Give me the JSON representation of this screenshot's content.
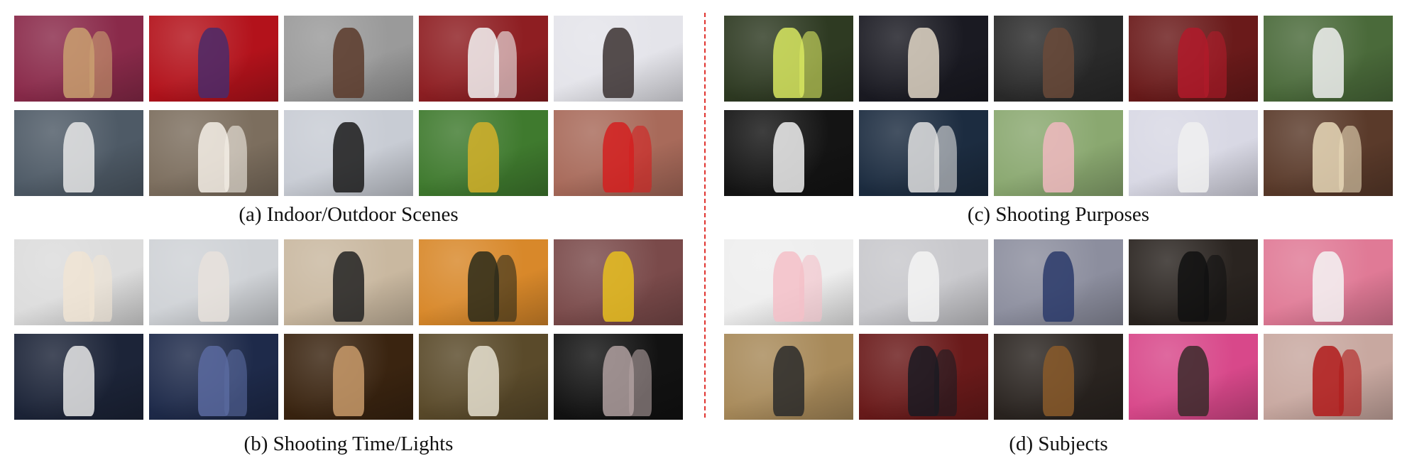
{
  "captions": {
    "a": "(a) Indoor/Outdoor Scenes",
    "b": "(b) Shooting Time/Lights",
    "c": "(c) Shooting Purposes",
    "d": "(d) Subjects"
  },
  "colors": {
    "divider": "#e0332f"
  },
  "panels": {
    "a": [
      {
        "bg": "#8a2a4a",
        "fg": "#c9a070"
      },
      {
        "bg": "#b3121b",
        "fg": "#4a2a6a"
      },
      {
        "bg": "#9a9a9a",
        "fg": "#5a3a2a"
      },
      {
        "bg": "#8e1e22",
        "fg": "#f2f2f2"
      },
      {
        "bg": "#e4e4ea",
        "fg": "#3a3030"
      },
      {
        "bg": "#4e5a66",
        "fg": "#e8e8e8"
      },
      {
        "bg": "#7c6e5e",
        "fg": "#f4efe6"
      },
      {
        "bg": "#c8ccd4",
        "fg": "#1a1a1a"
      },
      {
        "bg": "#3f7a2e",
        "fg": "#d4b02a"
      },
      {
        "bg": "#a86a5a",
        "fg": "#d42020"
      }
    ],
    "b": [
      {
        "bg": "#dcdcdc",
        "fg": "#f0e4d4"
      },
      {
        "bg": "#cfd2d6",
        "fg": "#e8e2dc"
      },
      {
        "bg": "#c9b8a0",
        "fg": "#222222"
      },
      {
        "bg": "#d8882a",
        "fg": "#2a2a1a"
      },
      {
        "bg": "#7a4a4a",
        "fg": "#e8c020"
      },
      {
        "bg": "#1c2438",
        "fg": "#e6e6e6"
      },
      {
        "bg": "#1e2a4a",
        "fg": "#5a6aa0"
      },
      {
        "bg": "#3a2410",
        "fg": "#c89a6a"
      },
      {
        "bg": "#5a4a2a",
        "fg": "#e6e0d0"
      },
      {
        "bg": "#121212",
        "fg": "#b0a0a0"
      }
    ],
    "c": [
      {
        "bg": "#2e3a22",
        "fg": "#d8e860"
      },
      {
        "bg": "#1a1a22",
        "fg": "#e0d6c6"
      },
      {
        "bg": "#2a2a2a",
        "fg": "#6a4a3a"
      },
      {
        "bg": "#6a1a1a",
        "fg": "#b01a2a"
      },
      {
        "bg": "#4a6a3a",
        "fg": "#f0f0f0"
      },
      {
        "bg": "#141414",
        "fg": "#f0f0f0"
      },
      {
        "bg": "#1c2c40",
        "fg": "#e0e0e0"
      },
      {
        "bg": "#8aa870",
        "fg": "#f0b8c0"
      },
      {
        "bg": "#d8d8e4",
        "fg": "#f0f0f0"
      },
      {
        "bg": "#5a3a2a",
        "fg": "#e8d8b8"
      }
    ],
    "d": [
      {
        "bg": "#eeeeee",
        "fg": "#f4c0c8"
      },
      {
        "bg": "#c8c8cc",
        "fg": "#f4f4f4"
      },
      {
        "bg": "#8c8e9e",
        "fg": "#2a3a6a"
      },
      {
        "bg": "#2a2420",
        "fg": "#111111"
      },
      {
        "bg": "#e07a96",
        "fg": "#f4f4f4"
      },
      {
        "bg": "#a88a5a",
        "fg": "#2a2a2a"
      },
      {
        "bg": "#6a1a1a",
        "fg": "#1a1a22"
      },
      {
        "bg": "#2a2420",
        "fg": "#8a5a2a"
      },
      {
        "bg": "#d8488a",
        "fg": "#3a2a2a"
      },
      {
        "bg": "#c8a8a0",
        "fg": "#b01a1a"
      }
    ]
  }
}
